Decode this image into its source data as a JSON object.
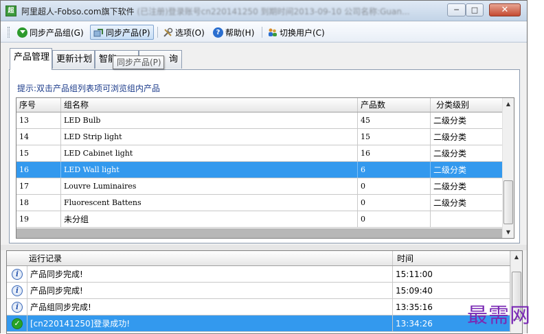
{
  "window": {
    "title_clear": "阿里超人-Fobso.com旗下软件",
    "title_blurred": "(已注册)登录账号cn220141250  到期时间2013-09-10  公司名称:Guan...",
    "min_glyph": "─",
    "max_glyph": "□",
    "close_glyph": "✕",
    "app_icon_text": "超"
  },
  "toolbar": {
    "items": [
      {
        "label": "同步产品组(G)",
        "icon": "green-down-arrow-icon"
      },
      {
        "label": "同步产品(P)",
        "icon": "sync-products-icon"
      },
      {
        "label": "选项(O)",
        "icon": "tools-icon"
      },
      {
        "label": "帮助(H)",
        "icon": "help-icon"
      },
      {
        "label": "切换用户(C)",
        "icon": "users-icon"
      }
    ]
  },
  "tooltip": "同步产品(P)",
  "tabs": [
    "产品管理",
    "更新计划",
    "智能...",
    "...查询"
  ],
  "tab_visible": [
    "产品管理",
    "更新计划",
    "智能",
    "询"
  ],
  "panel": {
    "hint": "提示:双击产品组列表项可浏览组内产品"
  },
  "group_table": {
    "columns": [
      "序号",
      "组名称",
      "产品数",
      "分类级别"
    ],
    "rows": [
      {
        "no": "13",
        "name": "LED Bulb",
        "count": "45",
        "level": "二级分类"
      },
      {
        "no": "14",
        "name": "LED Strip light",
        "count": "15",
        "level": "二级分类"
      },
      {
        "no": "15",
        "name": "LED Cabinet light",
        "count": "16",
        "level": "二级分类"
      },
      {
        "no": "16",
        "name": "LED Wall light",
        "count": "6",
        "level": "二级分类"
      },
      {
        "no": "17",
        "name": "Louvre Luminaires",
        "count": "0",
        "level": "二级分类"
      },
      {
        "no": "18",
        "name": "Fluorescent Battens",
        "count": "0",
        "level": "二级分类"
      },
      {
        "no": "19",
        "name": "未分组",
        "count": "0",
        "level": ""
      }
    ],
    "selected_index": 3
  },
  "log_table": {
    "columns": [
      "运行记录",
      "时间"
    ],
    "rows": [
      {
        "icon": "info-icon",
        "text": "产品同步完成!",
        "time": "15:11:00"
      },
      {
        "icon": "info-icon",
        "text": "产品同步完成!",
        "time": "15:09:40"
      },
      {
        "icon": "info-icon",
        "text": "产品组同步完成!",
        "time": "13:35:16"
      },
      {
        "icon": "success-check-icon",
        "text": "[cn220141250]登录成功!",
        "time": "13:34:26"
      }
    ],
    "selected_index": 3
  },
  "watermark": "最需网",
  "colors": {
    "selection": "#3399ee",
    "hint_text": "#1a3a8a",
    "watermark": "#7a2ab4"
  }
}
